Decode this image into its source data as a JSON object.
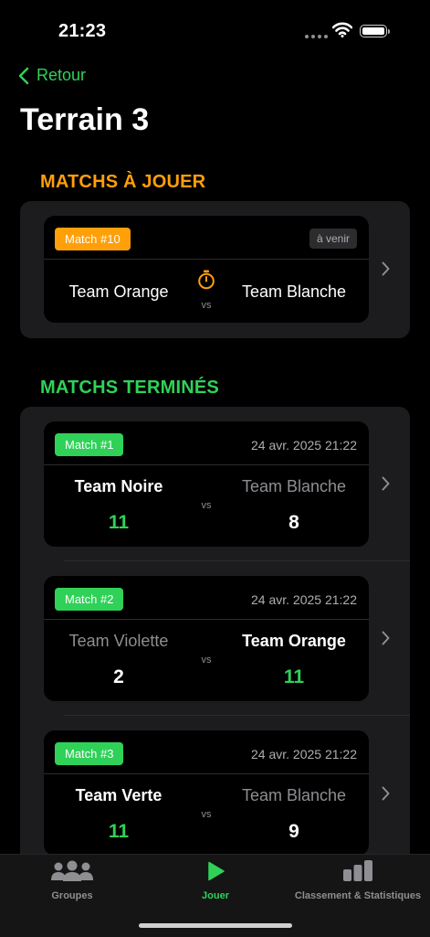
{
  "status_bar": {
    "time": "21:23"
  },
  "nav": {
    "back_label": "Retour",
    "title": "Terrain 3"
  },
  "sections": {
    "upcoming_header": "MATCHS À  JOUER",
    "finished_header": "MATCHS TERMINÉS"
  },
  "upcoming_match": {
    "badge": "Match #10",
    "status": "à venir",
    "team_left": "Team Orange",
    "team_right": "Team Blanche",
    "vs": "vs"
  },
  "finished_matches": [
    {
      "badge": "Match #1",
      "date": "24 avr. 2025 21:22",
      "team_left": "Team Noire",
      "team_right": "Team Blanche",
      "score_left": "11",
      "score_right": "8",
      "vs": "vs"
    },
    {
      "badge": "Match #2",
      "date": "24 avr. 2025 21:22",
      "team_left": "Team Violette",
      "team_right": "Team Orange",
      "score_left": "2",
      "score_right": "11",
      "vs": "vs"
    },
    {
      "badge": "Match #3",
      "date": "24 avr. 2025 21:22",
      "team_left": "Team Verte",
      "team_right": "Team Blanche",
      "score_left": "11",
      "score_right": "9",
      "vs": "vs"
    }
  ],
  "tab_bar": {
    "groups_label": "Groupes",
    "play_label": "Jouer",
    "stats_label": "Classement & Statistiques"
  },
  "colors": {
    "accent_green": "#30d158",
    "accent_orange": "#ff9f0a",
    "background": "#000000",
    "group_background": "#1c1c1e"
  }
}
